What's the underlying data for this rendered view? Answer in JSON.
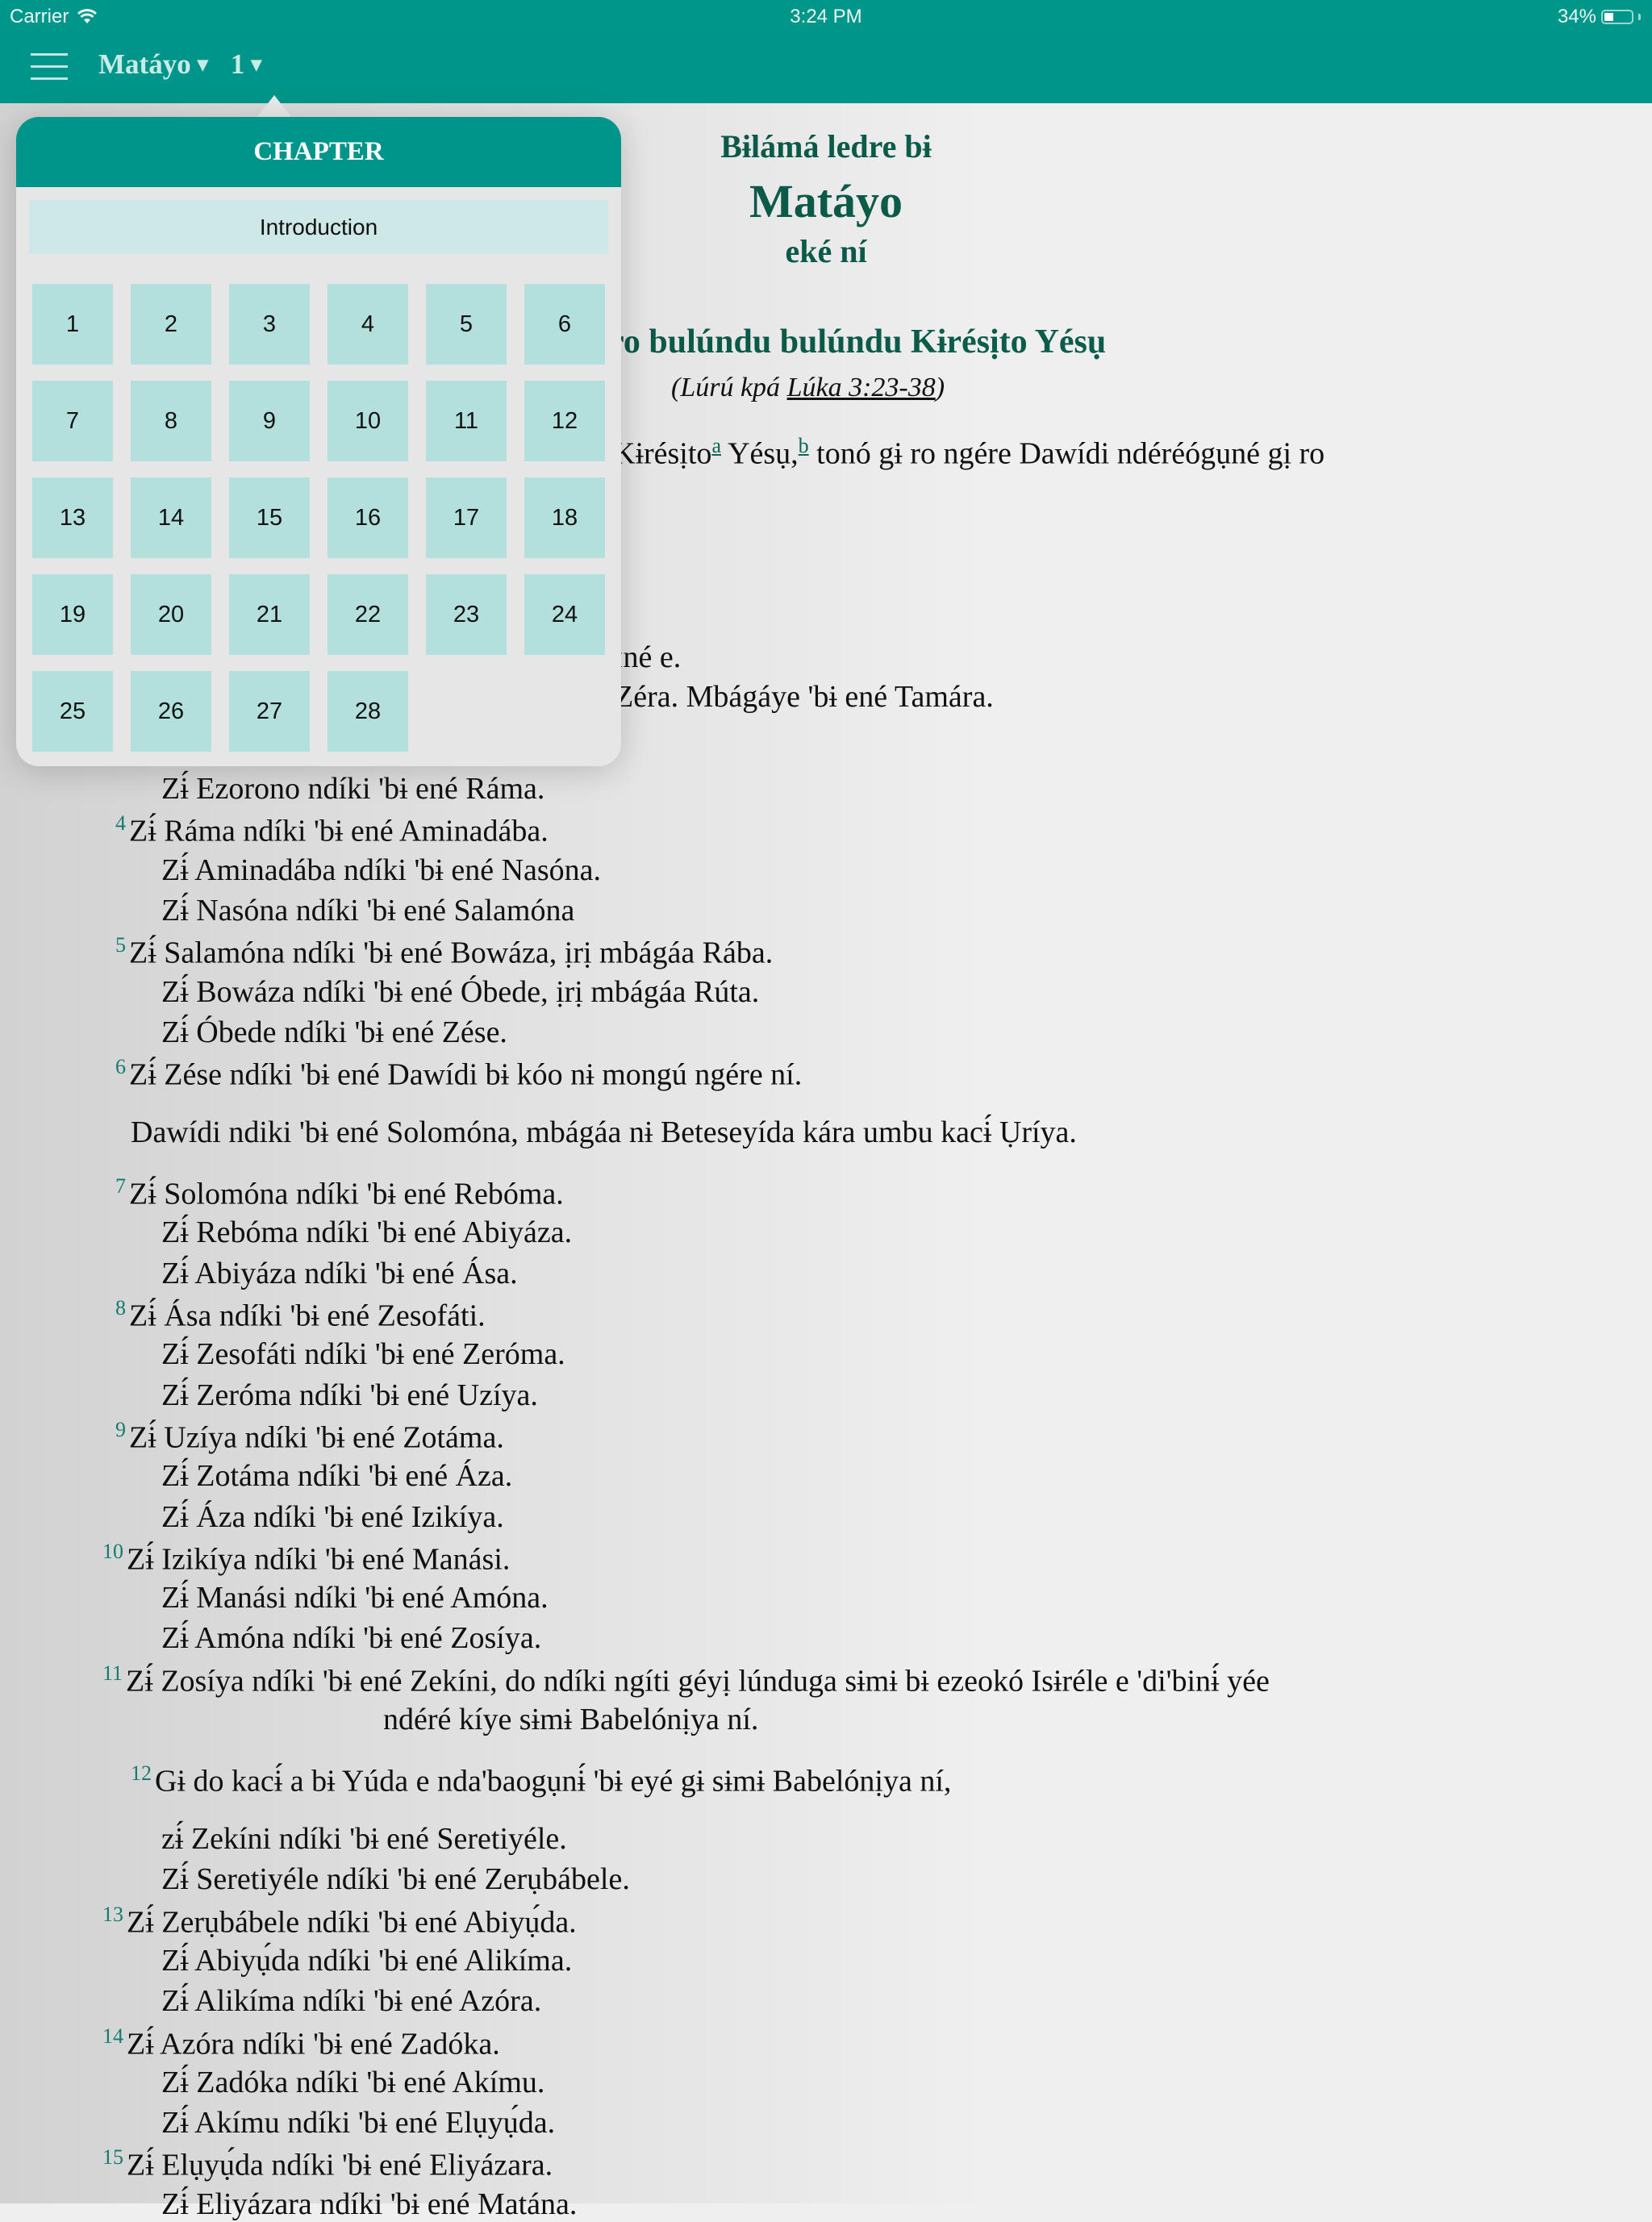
{
  "status_bar": {
    "carrier": "Carrier",
    "wifi_icon": "wifi-icon",
    "time": "3:24 PM",
    "battery_percent": "34%",
    "battery_level": 0.34
  },
  "navbar": {
    "menu_icon": "hamburger-menu-icon",
    "book": "Matáyo",
    "chapter": "1",
    "dropdown_glyph": "▾"
  },
  "chapter_popover": {
    "title": "CHAPTER",
    "introduction_label": "Introduction",
    "chapters": [
      "1",
      "2",
      "3",
      "4",
      "5",
      "6",
      "7",
      "8",
      "9",
      "10",
      "11",
      "12",
      "13",
      "14",
      "15",
      "16",
      "17",
      "18",
      "19",
      "20",
      "21",
      "22",
      "23",
      "24",
      "25",
      "26",
      "27",
      "28"
    ]
  },
  "book_header": {
    "line1": "Bɨlámá ledre bɨ",
    "line2": "Matáyo",
    "line3": "eké ní"
  },
  "section": {
    "heading_visible": "ro bulúndu bulúndu Kɨrésịto Yésụ",
    "crossref_prefix": "(Lúrú kpá ",
    "crossref_link": "Lúka 3:23-38",
    "crossref_suffix": ")"
  },
  "verse1_fragment": {
    "text_a": "Kɨrésịto",
    "footnote_a": "a",
    "text_b": " Yésụ,",
    "footnote_b": "b",
    "text_c": " tonó gɨ ro ngére Dawídi ndéréógụné gị ro"
  },
  "partial_lines": [
    "ɪné e.",
    "Zéra. Mbágáye 'bɨ ené Tamára."
  ],
  "lines": [
    {
      "verse": "",
      "text": "Zɨ́ Ezorono ndíki 'bɨ ené Ráma.",
      "indent": 1
    },
    {
      "verse": "4",
      "text": "Zɨ́ Ráma ndíki 'bɨ ené Aminadába.",
      "indent": 0
    },
    {
      "verse": "",
      "text": "Zɨ́ Aminadába ndíki 'bɨ ené Nasóna.",
      "indent": 1
    },
    {
      "verse": "",
      "text": "Zɨ́ Nasóna ndíki 'bɨ ené Salamóna",
      "indent": 1
    },
    {
      "verse": "5",
      "text": "Zɨ́ Salamóna ndíki 'bɨ ené Bowáza, ịrị mbágáa Rába.",
      "indent": 0
    },
    {
      "verse": "",
      "text": "Zɨ́ Bowáza ndíki 'bɨ ené Óbede, ịrị mbágáa Rúta.",
      "indent": 1
    },
    {
      "verse": "",
      "text": "Zɨ́ Óbede ndíki 'bɨ ené Zése.",
      "indent": 1
    },
    {
      "verse": "6",
      "text": "Zɨ́ Zése ndíki 'bɨ ené Dawídi bɨ kóo nɨ mongú ngére ní.",
      "indent": 0
    },
    {
      "verse": "",
      "text": "Dawídi ndiki 'bɨ ené Solomóna, mbágáa nɨ Beteseyída kára umbu kacɨ́ Ụríya.",
      "indent": -1
    },
    {
      "verse": "7",
      "text": "Zɨ́ Solomóna ndíki 'bɨ ené Rebóma.",
      "indent": 0
    },
    {
      "verse": "",
      "text": "Zɨ́ Rebóma ndíki 'bɨ ené Abiyáza.",
      "indent": 1
    },
    {
      "verse": "",
      "text": "Zɨ́ Abiyáza ndíki 'bɨ ené Ása.",
      "indent": 1
    },
    {
      "verse": "8",
      "text": "Zɨ́ Ása ndíki 'bɨ ené Zesofáti.",
      "indent": 0
    },
    {
      "verse": "",
      "text": "Zɨ́ Zesofáti ndíki 'bɨ ené Zeróma.",
      "indent": 1
    },
    {
      "verse": "",
      "text": "Zɨ́ Zeróma ndíki 'bɨ ené Uzíya.",
      "indent": 1
    },
    {
      "verse": "9",
      "text": "Zɨ́ Uzíya ndíki 'bɨ ené Zotáma.",
      "indent": 0
    },
    {
      "verse": "",
      "text": "Zɨ́ Zotáma ndíki 'bɨ ené Áza.",
      "indent": 1
    },
    {
      "verse": "",
      "text": "Zɨ́ Áza ndíki 'bɨ ené Izikíya.",
      "indent": 1
    },
    {
      "verse": "10",
      "text": "Zɨ́ Izikíya ndíki 'bɨ ené Manási.",
      "indent": 0
    },
    {
      "verse": "",
      "text": "Zɨ́ Manási ndíki 'bɨ ené Amóna.",
      "indent": 1
    },
    {
      "verse": "",
      "text": "Zɨ́ Amóna ndíki 'bɨ ené Zosíya.",
      "indent": 1
    },
    {
      "verse": "11",
      "text": "Zɨ́ Zosíya ndíki 'bɨ ené Zekíni, do ndíki ngíti géyị lúnduga sɨmɨ bɨ ezeokó Isɨréle e 'di'binɨ́ yée",
      "indent": 0
    },
    {
      "verse": "",
      "text": "ndéré kíye sɨmɨ Babelónịya ní.",
      "indent": 2
    },
    {
      "verse": "12",
      "text": "Gɨ do kacɨ́ a bɨ Yúda e nda'baogụnɨ́ 'bɨ eyé gɨ sɨmɨ Babelónịya ní,",
      "indent": 3
    },
    {
      "verse": "",
      "text": "zɨ́ Zekíni ndíki 'bɨ ené Seretiyéle.",
      "indent": 1
    },
    {
      "verse": "",
      "text": "Zɨ́ Seretiyéle ndíki 'bɨ ené Zerụbábele.",
      "indent": 1
    },
    {
      "verse": "13",
      "text": "Zɨ́ Zerụbábele ndíki 'bɨ ené Abiyụ́da.",
      "indent": 0
    },
    {
      "verse": "",
      "text": "Zɨ́ Abiyụ́da ndíki 'bɨ ené Alikíma.",
      "indent": 1
    },
    {
      "verse": "",
      "text": "Zɨ́ Alikíma ndíki 'bɨ ené Azóra.",
      "indent": 1
    },
    {
      "verse": "14",
      "text": "Zɨ́ Azóra ndíki 'bɨ ené Zadóka.",
      "indent": 0
    },
    {
      "verse": "",
      "text": "Zɨ́ Zadóka ndíki 'bɨ ené Akímu.",
      "indent": 1
    },
    {
      "verse": "",
      "text": "Zɨ́ Akímu ndíki 'bɨ ené Elụyụ́da.",
      "indent": 1
    },
    {
      "verse": "15",
      "text": "Zɨ́ Elụyụ́da ndíki 'bɨ ené Eliyázara.",
      "indent": 0
    },
    {
      "verse": "",
      "text": "Zɨ́ Eliyázara ndíki 'bɨ ené Matána.",
      "indent": 1
    }
  ],
  "colors": {
    "brand_teal": "#00958a",
    "heading_green": "#0b5c4a",
    "verse_number": "#168a7c",
    "chapter_tile": "#b3e0dc",
    "intro_button": "#cde8e6"
  }
}
